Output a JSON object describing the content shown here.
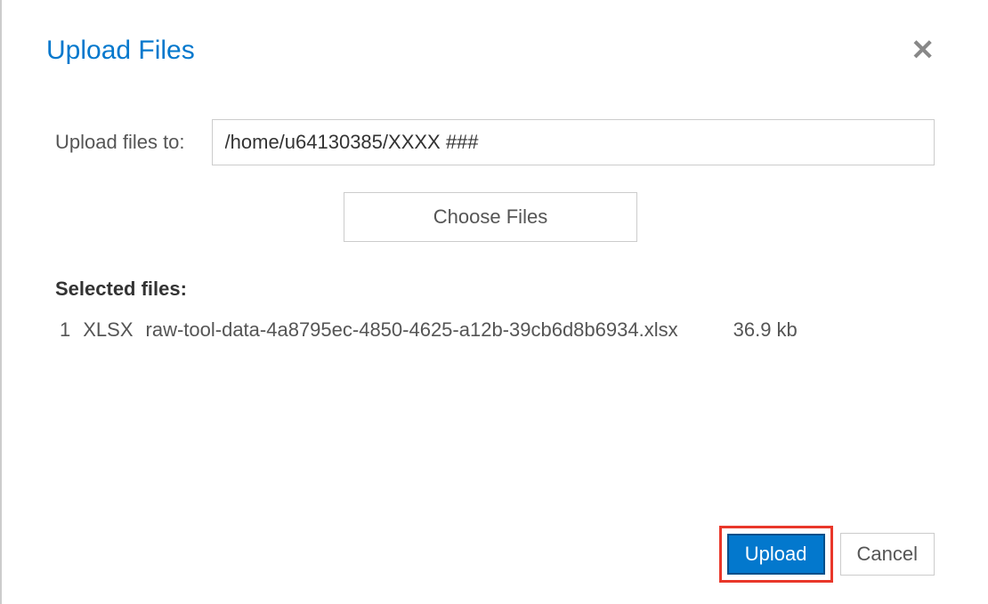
{
  "dialog": {
    "title": "Upload Files",
    "close_label": "✕"
  },
  "form": {
    "upload_path_label": "Upload files to:",
    "upload_path_value": "/home/u64130385/XXXX ###",
    "choose_files_label": "Choose Files",
    "selected_files_label": "Selected files:"
  },
  "files": [
    {
      "index": "1",
      "ext": "XLSX",
      "name": "raw-tool-data-4a8795ec-4850-4625-a12b-39cb6d8b6934.xlsx",
      "size": "36.9 kb"
    }
  ],
  "footer": {
    "upload_label": "Upload",
    "cancel_label": "Cancel"
  }
}
